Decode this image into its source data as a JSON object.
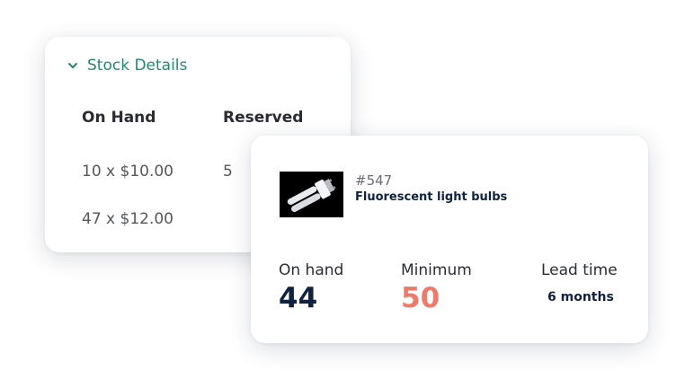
{
  "stock_details": {
    "title": "Stock Details",
    "columns": [
      "On Hand",
      "Reserved"
    ],
    "rows": [
      {
        "on_hand": "10 x $10.00",
        "reserved": "5"
      },
      {
        "on_hand": "47 x $12.00",
        "reserved": ""
      }
    ],
    "chevron_icon": "chevron-down-icon",
    "accent_color": "#1f8a70"
  },
  "item": {
    "id": "#547",
    "name": "Fluorescent light bulbs",
    "image_icon": "light-bulb-image",
    "metrics": {
      "on_hand": {
        "label": "On hand",
        "value": "44",
        "color": "#0f2240"
      },
      "minimum": {
        "label": "Minimum",
        "value": "50",
        "color": "#f07a6a"
      },
      "lead_time": {
        "label": "Lead time",
        "value": "6 months",
        "color": "#0f2240"
      }
    }
  }
}
